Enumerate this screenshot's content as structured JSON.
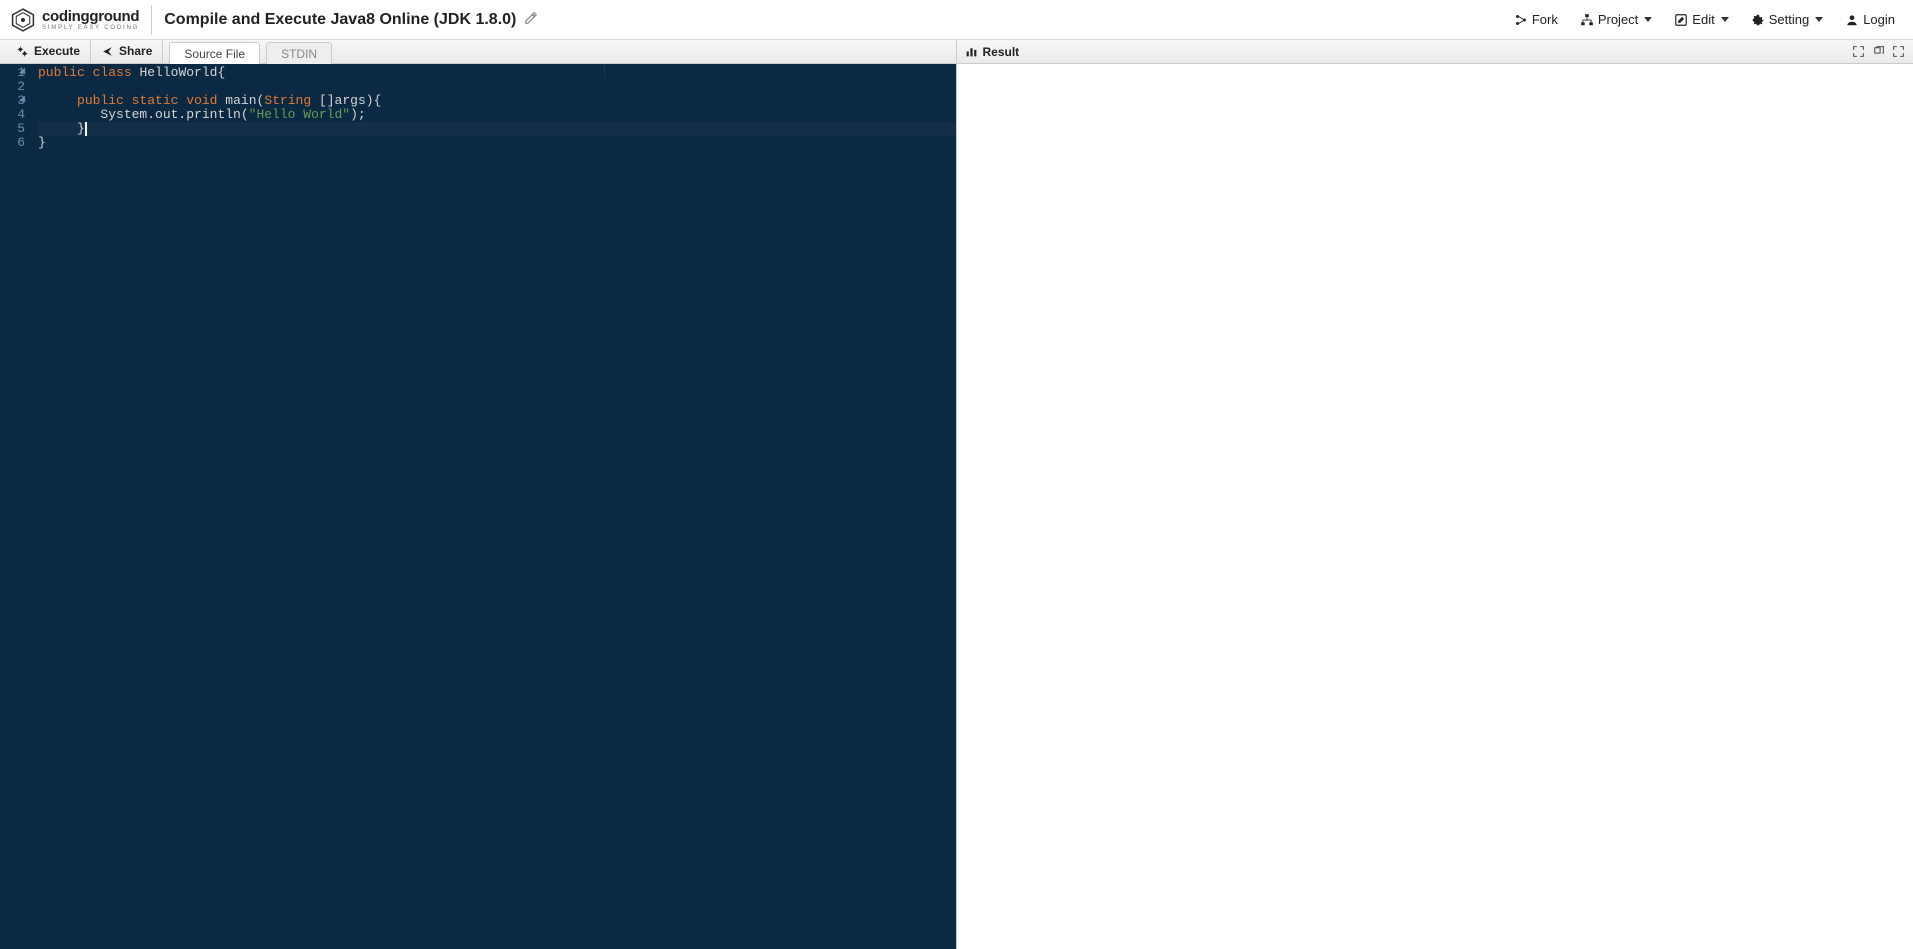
{
  "logo": {
    "line1_prefix": "coding",
    "line1_bold": "ground",
    "line2": "SIMPLY EASY CODING"
  },
  "page_title": "Compile and Execute Java8 Online (JDK 1.8.0)",
  "header_buttons": {
    "fork": "Fork",
    "project": "Project",
    "edit": "Edit",
    "setting": "Setting",
    "login": "Login"
  },
  "left_toolbar": {
    "execute": "Execute",
    "share": "Share"
  },
  "tabs": {
    "source": "Source File",
    "stdin": "STDIN"
  },
  "result_label": "Result",
  "code": {
    "line_numbers": [
      "1",
      "2",
      "3",
      "4",
      "5",
      "6"
    ],
    "l1": {
      "kw1": "public",
      "kw2": "class",
      "cls": "HelloWorld",
      "brace": "{"
    },
    "l3": {
      "indent": "     ",
      "kw1": "public",
      "kw2": "static",
      "kw3": "void",
      "fn": "main",
      "paren_open": "(",
      "type": "String",
      "args": " []args",
      "paren_close": ")",
      "brace": "{"
    },
    "l4": {
      "indent": "        ",
      "obj": "System.out.println(",
      "str": "\"Hello World\"",
      "end": ");"
    },
    "l5": {
      "indent": "     ",
      "brace": "}"
    },
    "l6": {
      "brace": "}"
    }
  }
}
